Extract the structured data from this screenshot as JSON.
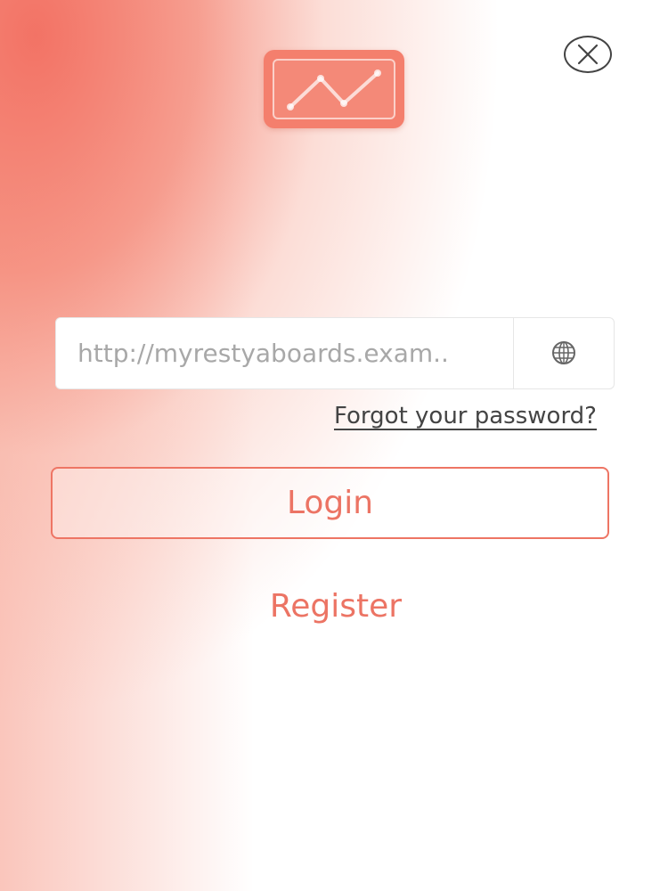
{
  "form": {
    "url_placeholder": "http://myrestyaboards.exam..",
    "forgot_password": "Forgot your password?",
    "login_label": "Login",
    "register_label": "Register"
  },
  "icons": {
    "logo": "line-chart-icon",
    "close": "close-icon",
    "server": "globe-icon"
  },
  "colors": {
    "accent": "#ec7464",
    "logo_bg": "#f47f6d",
    "text_dark": "#444444",
    "placeholder": "#a8a8a8"
  }
}
